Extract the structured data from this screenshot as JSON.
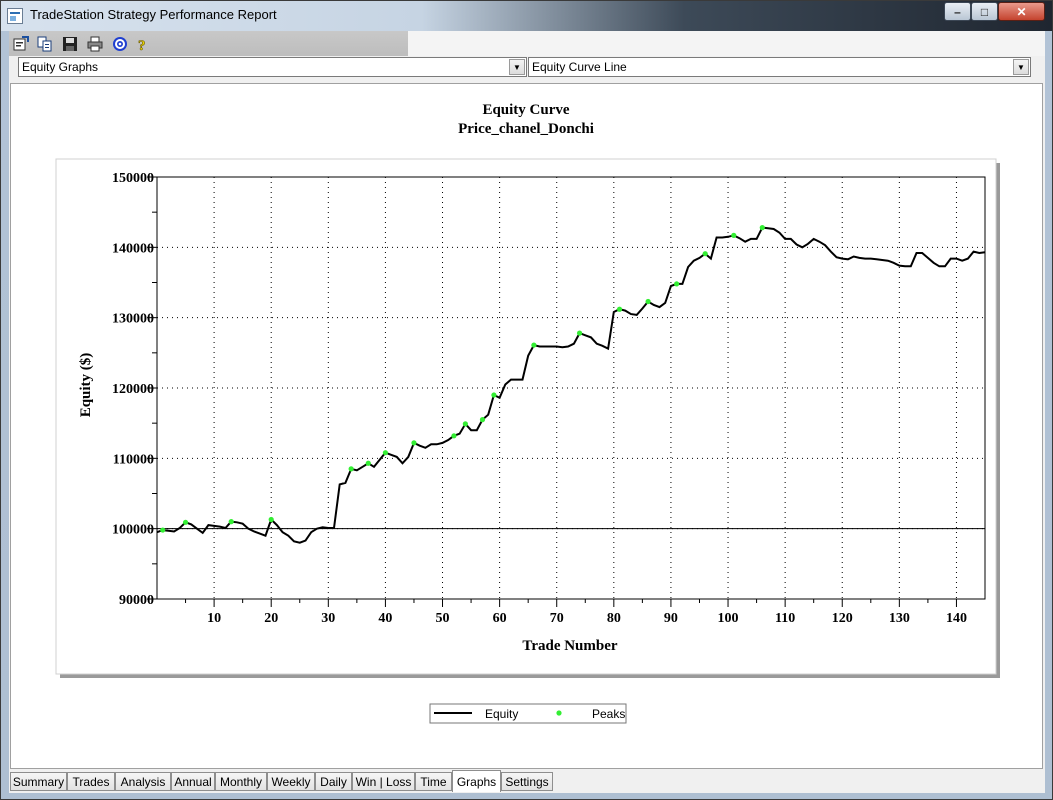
{
  "window": {
    "title": "TradeStation Strategy Performance Report"
  },
  "toolbar": {
    "icons": [
      "properties-icon",
      "copy-icon",
      "save-icon",
      "print-icon",
      "target-icon",
      "help-icon"
    ]
  },
  "dropdowns": {
    "report_type": "Equity Graphs",
    "graph_type": "Equity Curve Line"
  },
  "legend": {
    "equity": "Equity",
    "peaks": "Peaks"
  },
  "tabs": [
    "Summary",
    "Trades",
    "Analysis",
    "Annual",
    "Monthly",
    "Weekly",
    "Daily",
    "Win | Loss",
    "Time",
    "Graphs",
    "Settings"
  ],
  "active_tab": "Graphs",
  "colors": {
    "peak": "#33ee33",
    "line": "#000000"
  },
  "chart_data": {
    "type": "line",
    "title": "Equity Curve",
    "subtitle": "Price_chanel_Donchi",
    "xlabel": "Trade Number",
    "ylabel": "Equity ($)",
    "xlim": [
      0,
      145
    ],
    "ylim": [
      90000,
      150000
    ],
    "xticks": [
      10,
      20,
      30,
      40,
      50,
      60,
      70,
      80,
      90,
      100,
      110,
      120,
      130,
      140
    ],
    "yticks": [
      90000,
      100000,
      110000,
      120000,
      130000,
      140000,
      150000
    ],
    "grid": true,
    "legend_position": "bottom",
    "series": [
      {
        "name": "Equity",
        "style": "line",
        "points": [
          [
            0,
            99500
          ],
          [
            1,
            99800
          ],
          [
            2,
            99700
          ],
          [
            3,
            99600
          ],
          [
            4,
            100100
          ],
          [
            5,
            100900
          ],
          [
            6,
            100600
          ],
          [
            7,
            100000
          ],
          [
            8,
            99400
          ],
          [
            9,
            100500
          ],
          [
            10,
            100400
          ],
          [
            11,
            100300
          ],
          [
            12,
            100100
          ],
          [
            13,
            101000
          ],
          [
            14,
            100900
          ],
          [
            15,
            100700
          ],
          [
            16,
            100000
          ],
          [
            17,
            99600
          ],
          [
            18,
            99300
          ],
          [
            19,
            99000
          ],
          [
            20,
            101300
          ],
          [
            21,
            100500
          ],
          [
            22,
            99500
          ],
          [
            23,
            99000
          ],
          [
            24,
            98200
          ],
          [
            25,
            98000
          ],
          [
            26,
            98300
          ],
          [
            27,
            99500
          ],
          [
            28,
            100000
          ],
          [
            29,
            100200
          ],
          [
            30,
            100100
          ],
          [
            31,
            100100
          ],
          [
            32,
            106300
          ],
          [
            33,
            106500
          ],
          [
            34,
            108500
          ],
          [
            35,
            108300
          ],
          [
            36,
            108800
          ],
          [
            37,
            109300
          ],
          [
            38,
            108800
          ],
          [
            39,
            109800
          ],
          [
            40,
            110800
          ],
          [
            41,
            110500
          ],
          [
            42,
            110200
          ],
          [
            43,
            109300
          ],
          [
            44,
            110200
          ],
          [
            45,
            112200
          ],
          [
            46,
            111800
          ],
          [
            47,
            111500
          ],
          [
            48,
            112000
          ],
          [
            49,
            112000
          ],
          [
            50,
            112200
          ],
          [
            51,
            112600
          ],
          [
            52,
            113200
          ],
          [
            53,
            113500
          ],
          [
            54,
            114900
          ],
          [
            55,
            114000
          ],
          [
            56,
            114000
          ],
          [
            57,
            115500
          ],
          [
            58,
            116200
          ],
          [
            59,
            119000
          ],
          [
            60,
            118600
          ],
          [
            61,
            120500
          ],
          [
            62,
            121200
          ],
          [
            63,
            121200
          ],
          [
            64,
            121200
          ],
          [
            65,
            124600
          ],
          [
            66,
            126100
          ],
          [
            67,
            125900
          ],
          [
            68,
            125900
          ],
          [
            69,
            125900
          ],
          [
            70,
            125900
          ],
          [
            71,
            125800
          ],
          [
            72,
            125900
          ],
          [
            73,
            126300
          ],
          [
            74,
            127800
          ],
          [
            75,
            127500
          ],
          [
            76,
            127200
          ],
          [
            77,
            126300
          ],
          [
            78,
            126000
          ],
          [
            79,
            125600
          ],
          [
            80,
            130800
          ],
          [
            81,
            131200
          ],
          [
            82,
            131000
          ],
          [
            83,
            130500
          ],
          [
            84,
            130400
          ],
          [
            85,
            131300
          ],
          [
            86,
            132300
          ],
          [
            87,
            131800
          ],
          [
            88,
            131500
          ],
          [
            89,
            132100
          ],
          [
            90,
            134500
          ],
          [
            91,
            134800
          ],
          [
            92,
            134800
          ],
          [
            93,
            137200
          ],
          [
            94,
            138100
          ],
          [
            95,
            138500
          ],
          [
            96,
            139100
          ],
          [
            97,
            138400
          ],
          [
            98,
            141400
          ],
          [
            99,
            141400
          ],
          [
            100,
            141500
          ],
          [
            101,
            141700
          ],
          [
            102,
            141300
          ],
          [
            103,
            140800
          ],
          [
            104,
            141200
          ],
          [
            105,
            141200
          ],
          [
            106,
            142800
          ],
          [
            107,
            142700
          ],
          [
            108,
            142600
          ],
          [
            109,
            142100
          ],
          [
            110,
            141200
          ],
          [
            111,
            141200
          ],
          [
            112,
            140400
          ],
          [
            113,
            140000
          ],
          [
            114,
            140500
          ],
          [
            115,
            141200
          ],
          [
            116,
            140800
          ],
          [
            117,
            140300
          ],
          [
            118,
            139400
          ],
          [
            119,
            138600
          ],
          [
            120,
            138400
          ],
          [
            121,
            138300
          ],
          [
            122,
            138700
          ],
          [
            123,
            138500
          ],
          [
            124,
            138400
          ],
          [
            125,
            138400
          ],
          [
            126,
            138300
          ],
          [
            127,
            138200
          ],
          [
            128,
            138100
          ],
          [
            129,
            137800
          ],
          [
            130,
            137400
          ],
          [
            131,
            137300
          ],
          [
            132,
            137300
          ],
          [
            133,
            139200
          ],
          [
            134,
            139200
          ],
          [
            135,
            138500
          ],
          [
            136,
            137800
          ],
          [
            137,
            137300
          ],
          [
            138,
            137300
          ],
          [
            139,
            138400
          ],
          [
            140,
            138400
          ],
          [
            141,
            138100
          ],
          [
            142,
            138400
          ],
          [
            143,
            139400
          ],
          [
            144,
            139200
          ],
          [
            145,
            139300
          ]
        ]
      },
      {
        "name": "Peaks",
        "style": "scatter",
        "points": [
          [
            1,
            99800
          ],
          [
            5,
            100900
          ],
          [
            13,
            101000
          ],
          [
            20,
            101300
          ],
          [
            34,
            108500
          ],
          [
            37,
            109300
          ],
          [
            40,
            110800
          ],
          [
            45,
            112200
          ],
          [
            52,
            113200
          ],
          [
            54,
            114900
          ],
          [
            57,
            115500
          ],
          [
            59,
            119000
          ],
          [
            66,
            126100
          ],
          [
            74,
            127800
          ],
          [
            81,
            131200
          ],
          [
            86,
            132300
          ],
          [
            91,
            134800
          ],
          [
            96,
            139100
          ],
          [
            101,
            141700
          ],
          [
            106,
            142800
          ]
        ]
      }
    ]
  }
}
